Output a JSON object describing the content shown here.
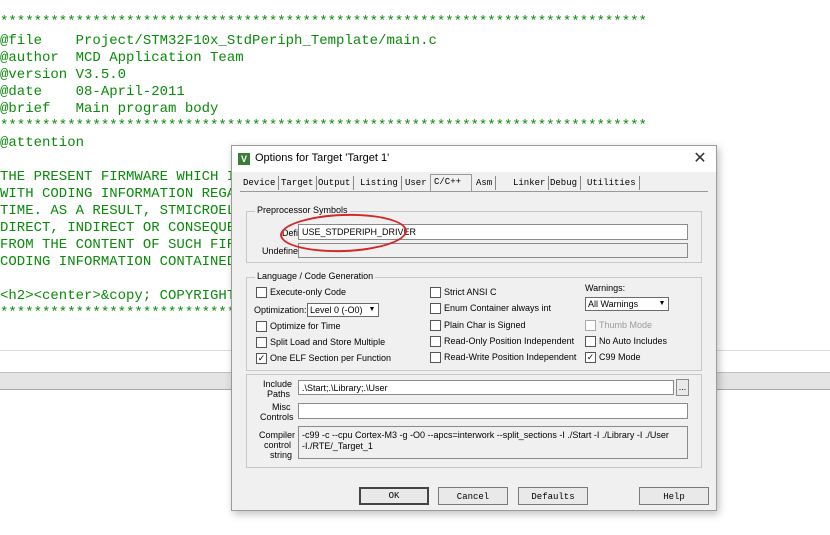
{
  "editor": {
    "lines": [
      "*****************************************************************************",
      "@file    Project/STM32F10x_StdPeriph_Template/main.c",
      "@author  MCD Application Team",
      "@version V3.5.0",
      "@date    08-April-2011",
      "@brief   Main program body",
      "*****************************************************************************",
      "@attention",
      "",
      "THE PRESENT FIRMWARE WHICH I",
      "WITH CODING INFORMATION REGA",
      "TIME. AS A RESULT, STMICROEL",
      "DIRECT, INDIRECT OR CONSEQUE",
      "FROM THE CONTENT OF SUCH FIR",
      "CODING INFORMATION CONTAINED",
      "",
      "<h2><center>&copy; COPYRIGHT",
      "*****************************"
    ]
  },
  "dialog": {
    "title": "Options for Target 'Target 1'",
    "close": "✕",
    "tabs": [
      "Device",
      "Target",
      "Output",
      "Listing",
      "User",
      "C/C++",
      "Asm",
      "Linker",
      "Debug",
      "Utilities"
    ],
    "preprocessor": {
      "group_label": "Preprocessor Symbols",
      "define_label": "Define:",
      "define_value": "USE_STDPERIPH_DRIVER",
      "undefine_label": "Undefine:",
      "undefine_value": ""
    },
    "language": {
      "group_label": "Language / Code Generation",
      "execute_only": "Execute-only Code",
      "optimization_label": "Optimization:",
      "optimization_value": "Level 0 (-O0)",
      "optimize_time": "Optimize for Time",
      "split_load": "Split Load and Store Multiple",
      "one_elf": "One ELF Section per Function",
      "strict_ansi": "Strict ANSI C",
      "enum_container": "Enum Container always int",
      "plain_char": "Plain Char is Signed",
      "ro_pi": "Read-Only Position Independent",
      "rw_pi": "Read-Write Position Independent",
      "warnings_label": "Warnings:",
      "warnings_value": "All Warnings",
      "thumb_mode": "Thumb Mode",
      "no_auto_includes": "No Auto Includes",
      "c99_mode": "C99 Mode",
      "check_mark": "✓"
    },
    "include": {
      "include_label_1": "Include",
      "include_label_2": "Paths",
      "include_value": ".\\Start;.\\Library;.\\User",
      "misc_label_1": "Misc",
      "misc_label_2": "Controls",
      "misc_value": "",
      "compiler_label_1": "Compiler",
      "compiler_label_2": "control",
      "compiler_label_3": "string",
      "compiler_line_1": "-c99 -c --cpu Cortex-M3 -g -O0 --apcs=interwork --split_sections -I ./Start -I ./Library -I ./User",
      "compiler_line_2": "-I./RTE/_Target_1",
      "ellipsis": "..."
    },
    "buttons": {
      "ok": "OK",
      "cancel": "Cancel",
      "defaults": "Defaults",
      "help": "Help"
    }
  }
}
